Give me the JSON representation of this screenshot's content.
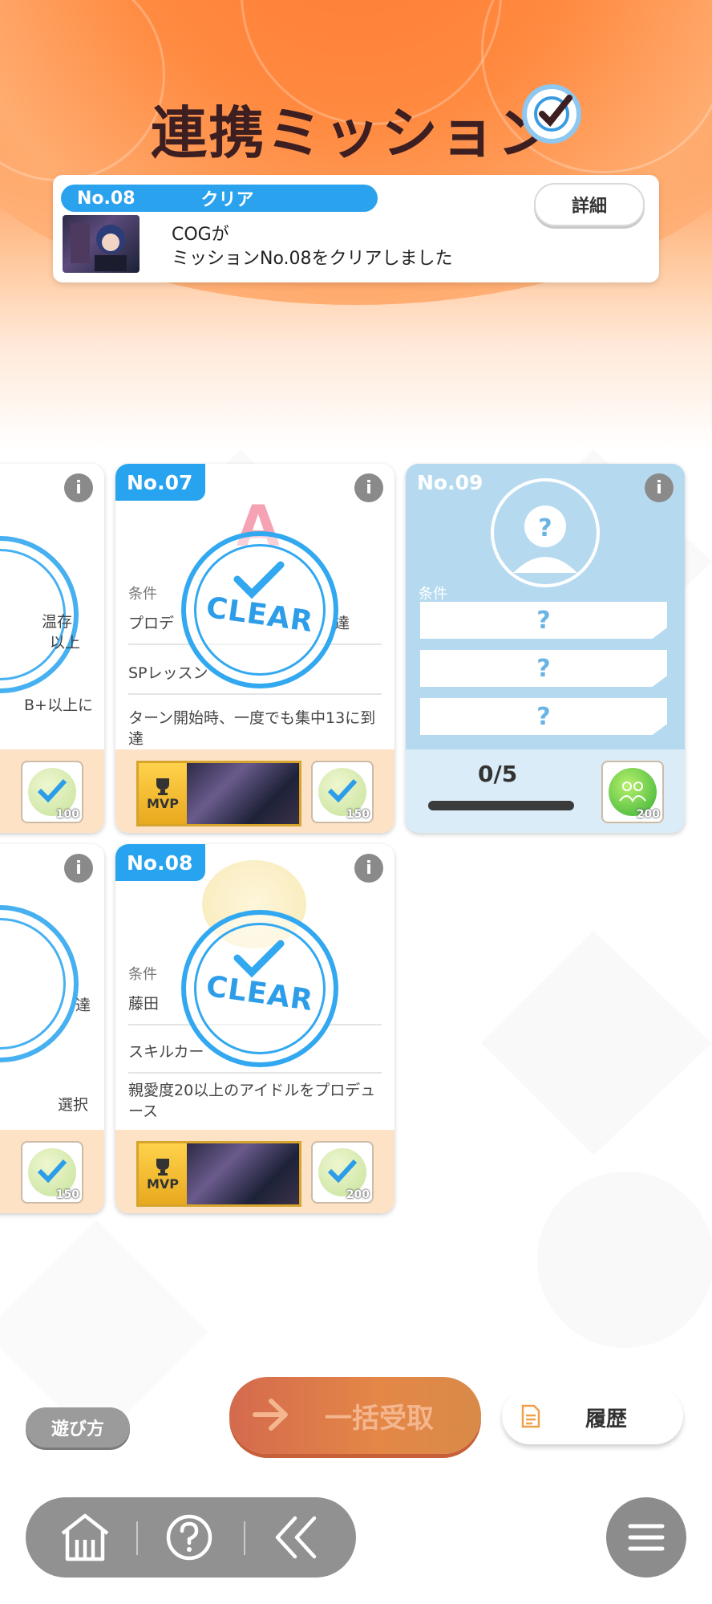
{
  "header": {
    "title": "連携ミッション"
  },
  "notice": {
    "no": "No.08",
    "state": "クリア",
    "detail_label": "詳細",
    "line1": "COGが",
    "line2": "ミッションNo.08をクリアしました"
  },
  "cards": {
    "partial_top": {
      "line1": "温存",
      "line2": "以上",
      "line3": "B+以上に",
      "reward_amount": "100"
    },
    "no07": {
      "no": "No.07",
      "cond_label": "条件",
      "cond1": "プロデ",
      "cond1_tail": "達",
      "cond2": "SPレッスン",
      "cond3": "ターン開始時、一度でも集中13に到達",
      "mvp_label": "MVP",
      "reward_amount": "150",
      "stamp": "CLEAR"
    },
    "no09": {
      "no": "No.09",
      "cond_label": "条件",
      "slot1": "?",
      "slot2": "?",
      "slot3": "?",
      "progress": "0/5",
      "progress_value": 0,
      "reward_amount": "200"
    },
    "partial_bottom": {
      "line1": "達",
      "line2": "選択",
      "reward_amount": "150"
    },
    "no08": {
      "no": "No.08",
      "cond_label": "条件",
      "cond1": "藤田",
      "cond2": "スキルカー",
      "cond3": "親愛度20以上のアイドルをプロデュース",
      "mvp_label": "MVP",
      "reward_amount": "200",
      "stamp": "CLEAR"
    }
  },
  "bottom": {
    "howto": "遊び方",
    "claim_all": "一括受取",
    "history": "履歴"
  },
  "icons": {
    "home": "home-icon",
    "help": "help-icon",
    "back": "back-icon",
    "menu": "menu-icon",
    "info": "info-icon"
  },
  "colors": {
    "accent_blue": "#28a3ef",
    "orange": "#ff8a45",
    "card_footer": "#fde2c6",
    "locked_card": "#b5daf0"
  }
}
